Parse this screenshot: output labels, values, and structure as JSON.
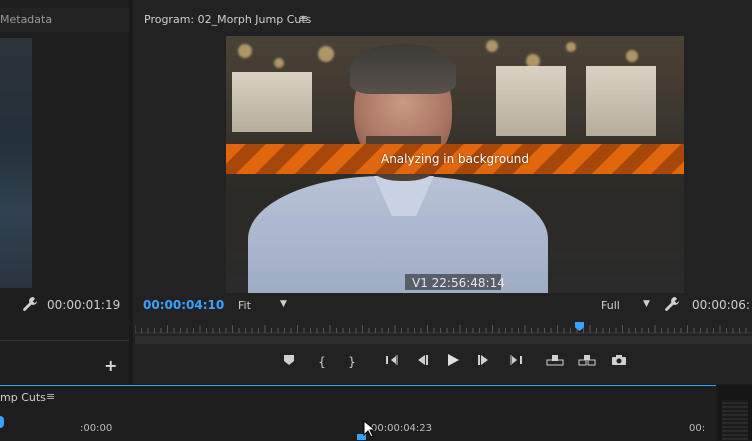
{
  "left_panel": {
    "tab_label": "Metadata",
    "timecode": "00:00:01:19",
    "add_label": "+"
  },
  "program_monitor": {
    "title": "Program: 02_Morph Jump Cuts",
    "menu_glyph": "≡",
    "overlay_message": "Analyzing in background",
    "clip_overlay": "V1 22:56:48:14",
    "current_timecode": "00:00:04:10",
    "zoom_select": "Fit",
    "resolution_select": "Full",
    "duration_timecode": "00:00:06:",
    "icons": [
      "wrench-icon"
    ],
    "accent_color": "#3aa3ff",
    "overlay_color": "#e0670e"
  },
  "transport": {
    "buttons": [
      {
        "name": "add-marker-button",
        "glyph": "⬟"
      },
      {
        "name": "mark-in-button",
        "glyph": "{"
      },
      {
        "name": "mark-out-button",
        "glyph": "}"
      },
      {
        "name": "go-to-in-button",
        "glyph": "{←"
      },
      {
        "name": "step-back-button",
        "glyph": "◀|"
      },
      {
        "name": "play-button",
        "glyph": "▶"
      },
      {
        "name": "step-forward-button",
        "glyph": "|▶"
      },
      {
        "name": "go-to-out-button",
        "glyph": "→}"
      },
      {
        "name": "lift-button",
        "glyph": "⇪"
      },
      {
        "name": "extract-button",
        "glyph": "⇩"
      },
      {
        "name": "export-frame-button",
        "glyph": "📷"
      }
    ]
  },
  "timeline": {
    "title": "mp Cuts",
    "menu_glyph": "≡",
    "start_time": ":00:00",
    "current_time": "00:00:04:23",
    "end_time": "00:"
  }
}
